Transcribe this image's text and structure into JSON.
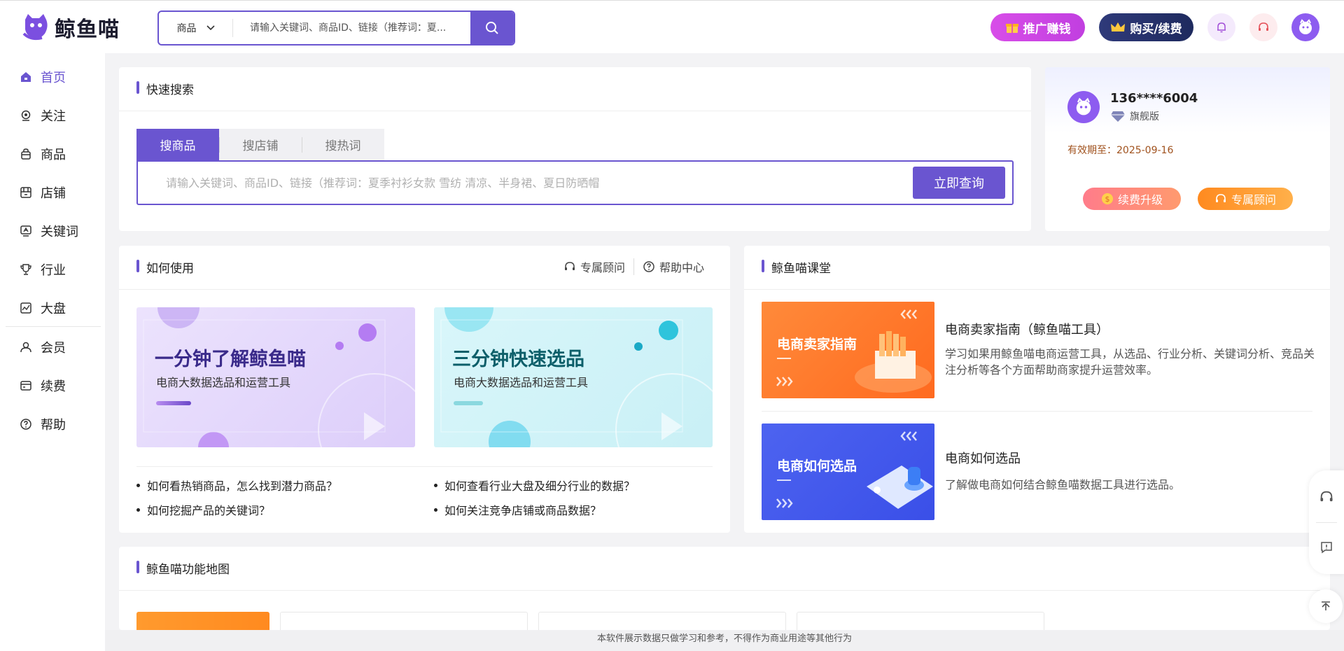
{
  "header": {
    "logo_text": "鲸鱼喵",
    "search_select": "商品",
    "search_placeholder": "请输入关键词、商品ID、链接（推荐词：夏...",
    "promo_label": "推广赚钱",
    "buy_label": "购买/续费"
  },
  "sidebar": {
    "items": [
      {
        "label": "首页",
        "icon": "home-icon"
      },
      {
        "label": "关注",
        "icon": "follow-icon"
      },
      {
        "label": "商品",
        "icon": "bag-icon"
      },
      {
        "label": "店铺",
        "icon": "shop-icon"
      },
      {
        "label": "关键词",
        "icon": "keyword-icon"
      },
      {
        "label": "行业",
        "icon": "trophy-icon"
      },
      {
        "label": "大盘",
        "icon": "dashboard-icon"
      },
      {
        "label": "会员",
        "icon": "member-icon"
      },
      {
        "label": "续费",
        "icon": "card-icon"
      },
      {
        "label": "帮助",
        "icon": "help-icon"
      }
    ]
  },
  "quick_search": {
    "title": "快速搜索",
    "tabs": [
      "搜商品",
      "搜店铺",
      "搜热词"
    ],
    "placeholder": "请输入关键词、商品ID、链接（推荐词：夏季衬衫女款 雪纺 清凉、半身裙、夏日防晒帽",
    "submit_label": "立即查询"
  },
  "user": {
    "phone": "136****6004",
    "level": "旗舰版",
    "expire": "有效期至：2025-09-16",
    "renew_label": "续费升级",
    "advisor_label": "专属顾问"
  },
  "howto": {
    "title": "如何使用",
    "link_advisor": "专属顾问",
    "link_help": "帮助中心",
    "banners": [
      {
        "title": "一分钟了解鲸鱼喵",
        "sub": "电商大数据选品和运营工具"
      },
      {
        "title": "三分钟快速选品",
        "sub": "电商大数据选品和运营工具"
      }
    ],
    "faqs": [
      "如何看热销商品，怎么找到潜力商品？",
      "如何查看行业大盘及细分行业的数据？",
      "如何挖掘产品的关键词？",
      "如何关注竞争店铺或商品数据？"
    ]
  },
  "courses": {
    "title": "鲸鱼喵课堂",
    "items": [
      {
        "img_text": "电商卖家指南",
        "title": "电商卖家指南（鲸鱼喵工具）",
        "desc": "学习如果用鲸鱼喵电商运营工具，从选品、行业分析、关键词分析、竞品关注分析等各个方面帮助商家提升运营效率。"
      },
      {
        "img_text": "电商如何选品",
        "title": "电商如何选品",
        "desc": "了解做电商如何结合鲸鱼喵数据工具进行选品。"
      }
    ]
  },
  "function_map": {
    "title": "鲸鱼喵功能地图"
  },
  "footer": {
    "note": "本软件展示数据只做学习和参考，不得作为商业用途等其他行为"
  }
}
